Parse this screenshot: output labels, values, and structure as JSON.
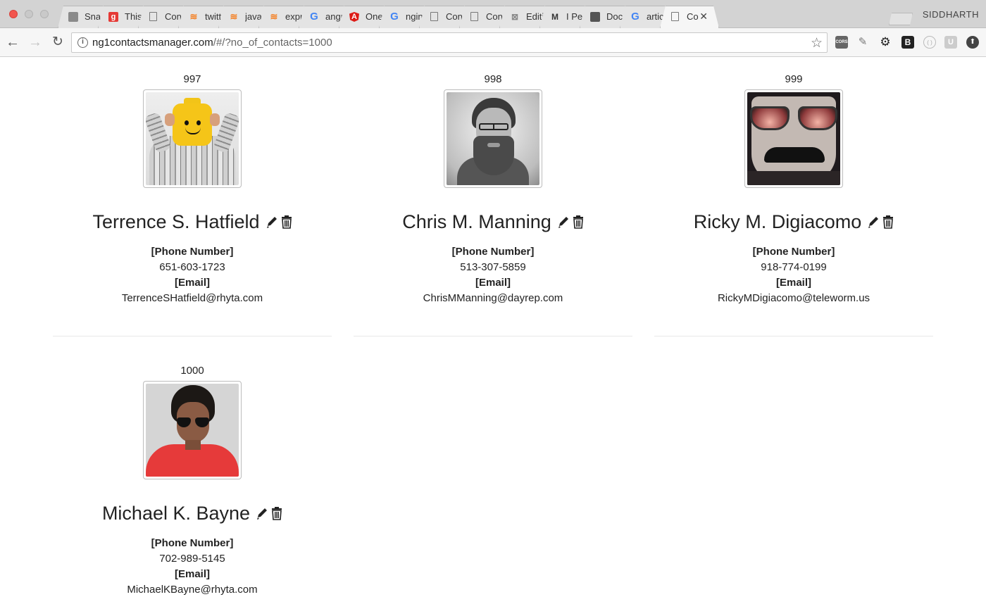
{
  "browser": {
    "tabs": [
      {
        "icon": "snap-icon",
        "title": "Snap",
        "active": false
      },
      {
        "icon": "red-square-icon",
        "title": "This",
        "active": false
      },
      {
        "icon": "document-icon",
        "title": "Cont",
        "active": false
      },
      {
        "icon": "stackoverflow-icon",
        "title": "twitte",
        "active": false
      },
      {
        "icon": "stackoverflow-icon",
        "title": "javas",
        "active": false
      },
      {
        "icon": "stackoverflow-icon",
        "title": "expre",
        "active": false
      },
      {
        "icon": "google-icon",
        "title": "angu",
        "active": false
      },
      {
        "icon": "angular-icon",
        "title": "One t",
        "active": false
      },
      {
        "icon": "google-icon",
        "title": "nginx",
        "active": false
      },
      {
        "icon": "document-icon",
        "title": "Cont",
        "active": false
      },
      {
        "icon": "document-icon",
        "title": "Cont",
        "active": false
      },
      {
        "icon": "edit-page-icon",
        "title": "Editir",
        "active": false
      },
      {
        "icon": "medium-icon",
        "title": "I Pee",
        "active": false
      },
      {
        "icon": "book-icon",
        "title": "Docu",
        "active": false
      },
      {
        "icon": "google-icon",
        "title": "articl",
        "active": false
      },
      {
        "icon": "document-icon",
        "title": "Co",
        "active": true
      }
    ],
    "profile_name": "SIDDHARTH",
    "url_host": "ng1contactsmanager.com",
    "url_path": "/#/?no_of_contacts=1000"
  },
  "contacts": [
    {
      "number": "997",
      "name": "Terrence S. Hatfield",
      "phone_label": "[Phone Number]",
      "phone": "651-603-1723",
      "email_label": "[Email]",
      "email": "TerrenceSHatfield@rhyta.com"
    },
    {
      "number": "998",
      "name": "Chris M. Manning",
      "phone_label": "[Phone Number]",
      "phone": "513-307-5859",
      "email_label": "[Email]",
      "email": "ChrisMManning@dayrep.com"
    },
    {
      "number": "999",
      "name": "Ricky M. Digiacomo",
      "phone_label": "[Phone Number]",
      "phone": "918-774-0199",
      "email_label": "[Email]",
      "email": "RickyMDigiacomo@teleworm.us"
    },
    {
      "number": "1000",
      "name": "Michael K. Bayne",
      "phone_label": "[Phone Number]",
      "phone": "702-989-5145",
      "email_label": "[Email]",
      "email": "MichaelKBayne@rhyta.com"
    }
  ]
}
